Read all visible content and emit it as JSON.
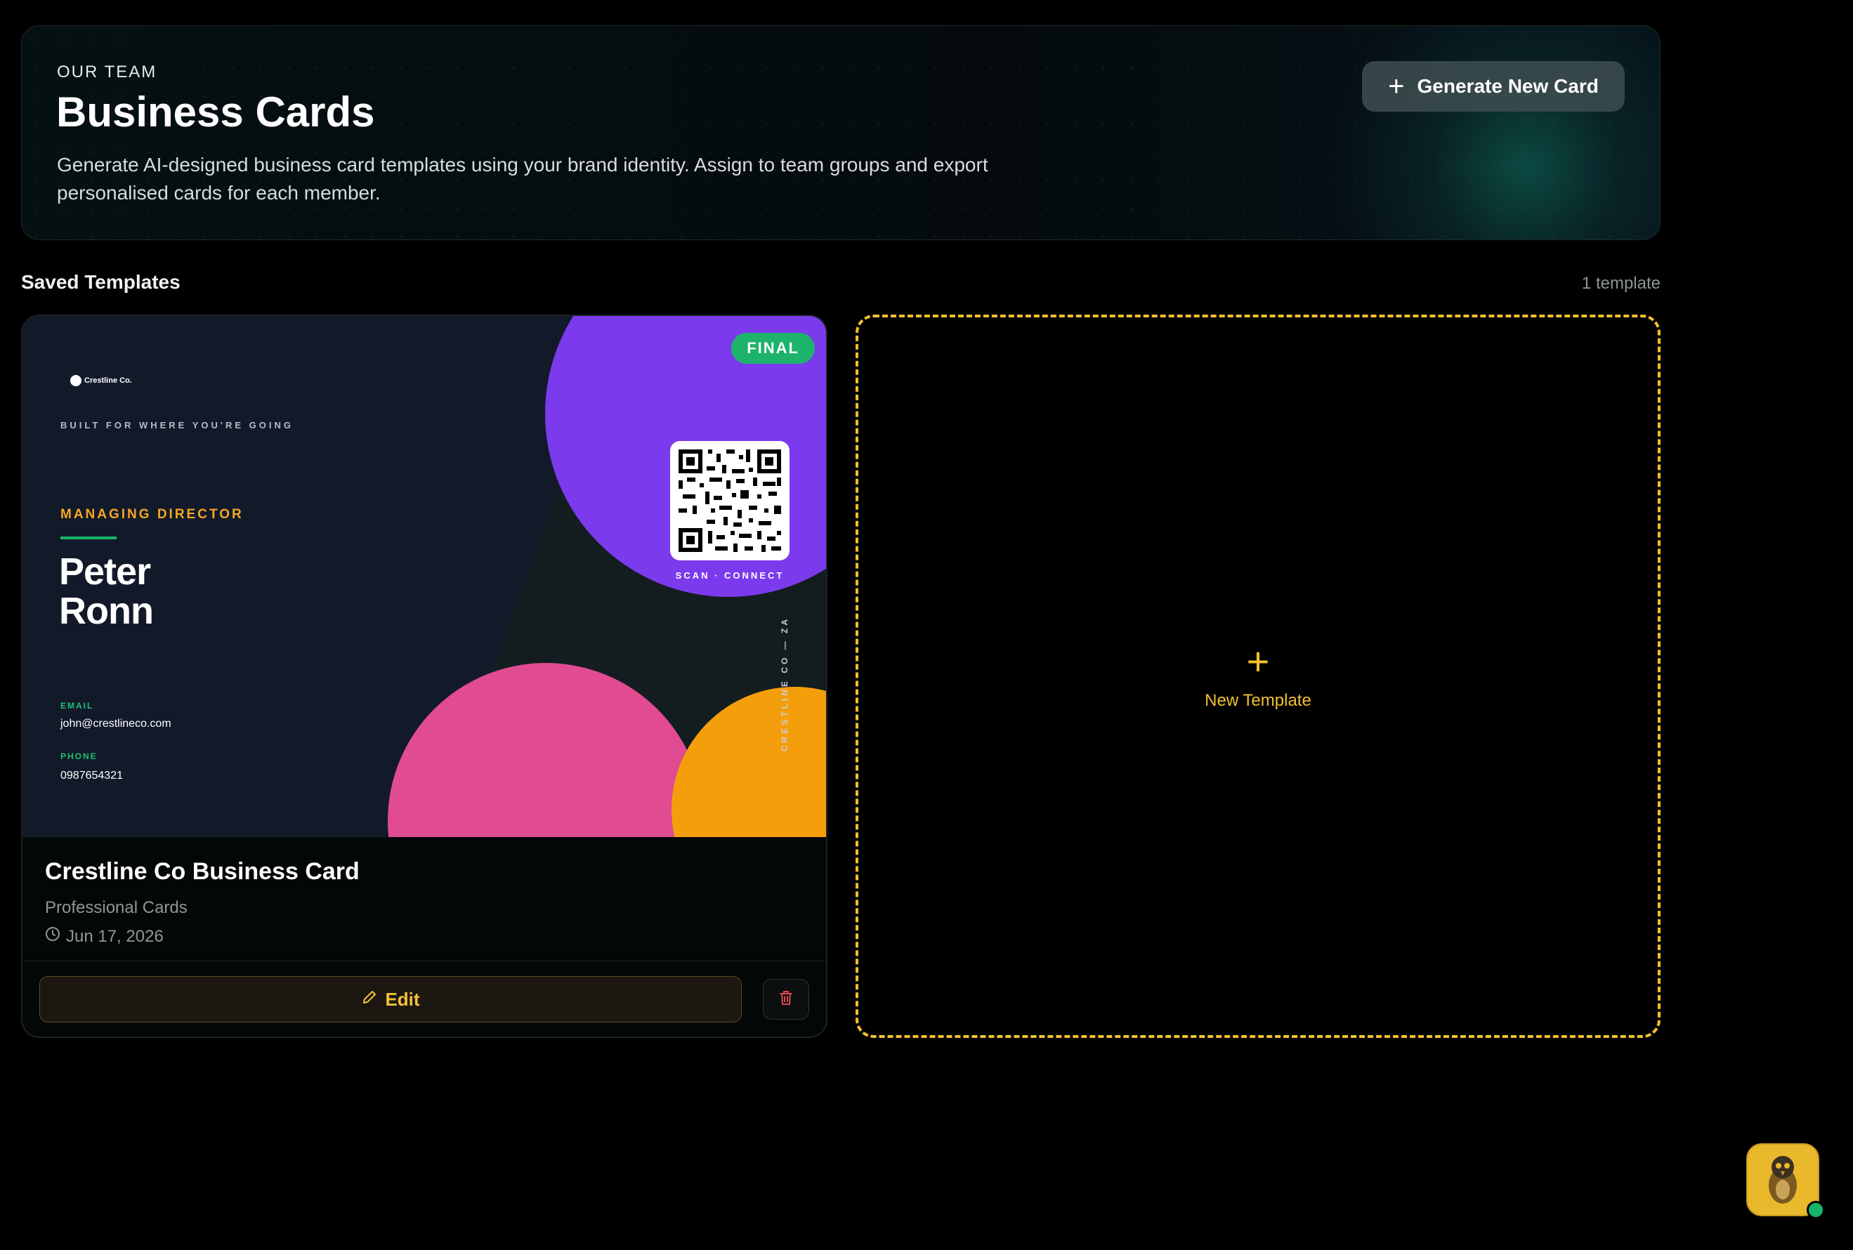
{
  "header": {
    "eyebrow": "OUR TEAM",
    "title": "Business Cards",
    "description": "Generate AI-designed business card templates using your brand identity. Assign to team groups and export personalised cards for each member.",
    "generate_button": "Generate New Card"
  },
  "section": {
    "title": "Saved Templates",
    "count": "1 template"
  },
  "template_card": {
    "badge": "FINAL",
    "preview": {
      "logo_text": "Crestline Co.",
      "tagline": "BUILT FOR WHERE YOU'RE GOING",
      "role": "MANAGING DIRECTOR",
      "first_name": "Peter",
      "last_name": "Ronn",
      "email_label": "EMAIL",
      "email": "john@crestlineco.com",
      "phone_label": "PHONE",
      "phone": "0987654321",
      "qr_caption": "SCAN · CONNECT",
      "vertical_text": "CRESTLINE CO — ZA"
    },
    "title": "Crestline Co Business Card",
    "category": "Professional Cards",
    "date": "Jun 17, 2026",
    "edit_label": "Edit"
  },
  "new_template": {
    "label": "New Template"
  },
  "colors": {
    "accent": "#f2c12e",
    "success": "#1db36b",
    "purple": "#7c3aed",
    "pink": "#e04b92",
    "orange": "#f59e0b"
  },
  "icons": [
    "plus-icon",
    "clock-icon",
    "pencil-icon",
    "trash-icon",
    "qr-code-icon",
    "assistant-avatar-icon"
  ]
}
